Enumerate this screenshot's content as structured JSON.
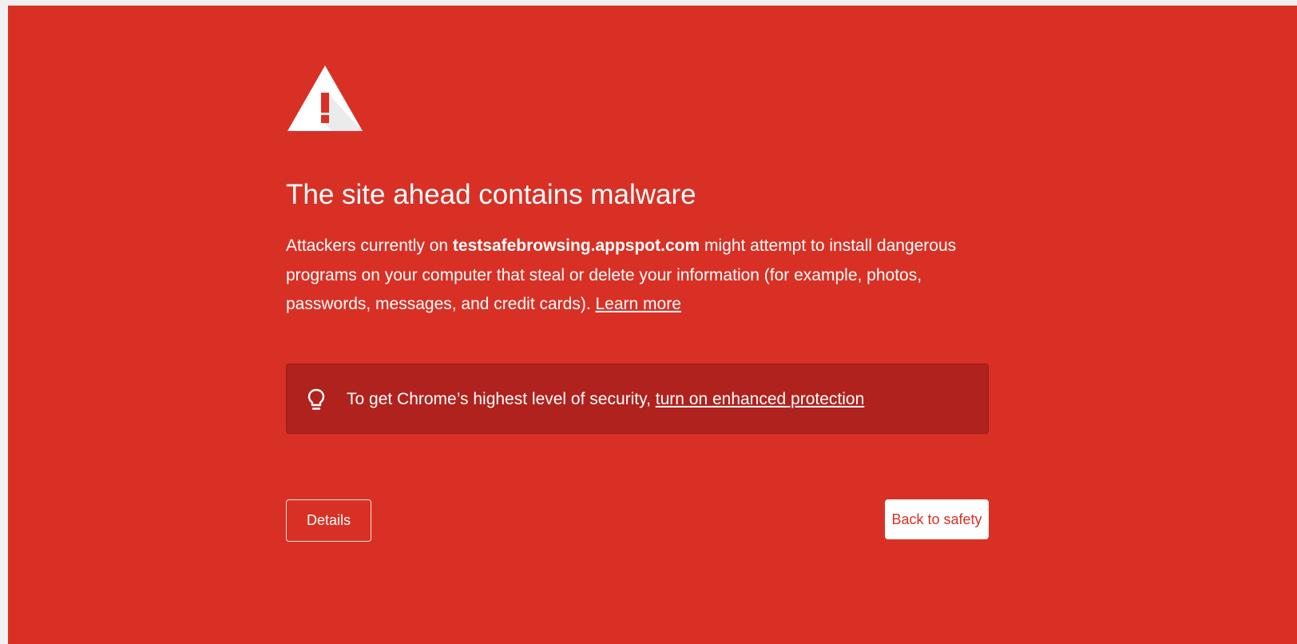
{
  "colors": {
    "background": "#d93025",
    "promo_background": "#b0221d",
    "text": "#ffffff",
    "primary_button_text": "#d93025"
  },
  "icons": {
    "warning": "warning-triangle-icon",
    "promo": "lightbulb-icon"
  },
  "warning": {
    "title": "The site ahead contains malware",
    "body_prefix": "Attackers currently on ",
    "domain": "testsafebrowsing.appspot.com",
    "body_suffix": " might attempt to install dangerous programs on your computer that steal or delete your information (for example, photos, passwords, messages, and credit cards). ",
    "learn_more": "Learn more"
  },
  "promo": {
    "text": "To get Chrome’s highest level of security, ",
    "link": "turn on enhanced protection"
  },
  "buttons": {
    "details": "Details",
    "back_to_safety": "Back to safety"
  }
}
